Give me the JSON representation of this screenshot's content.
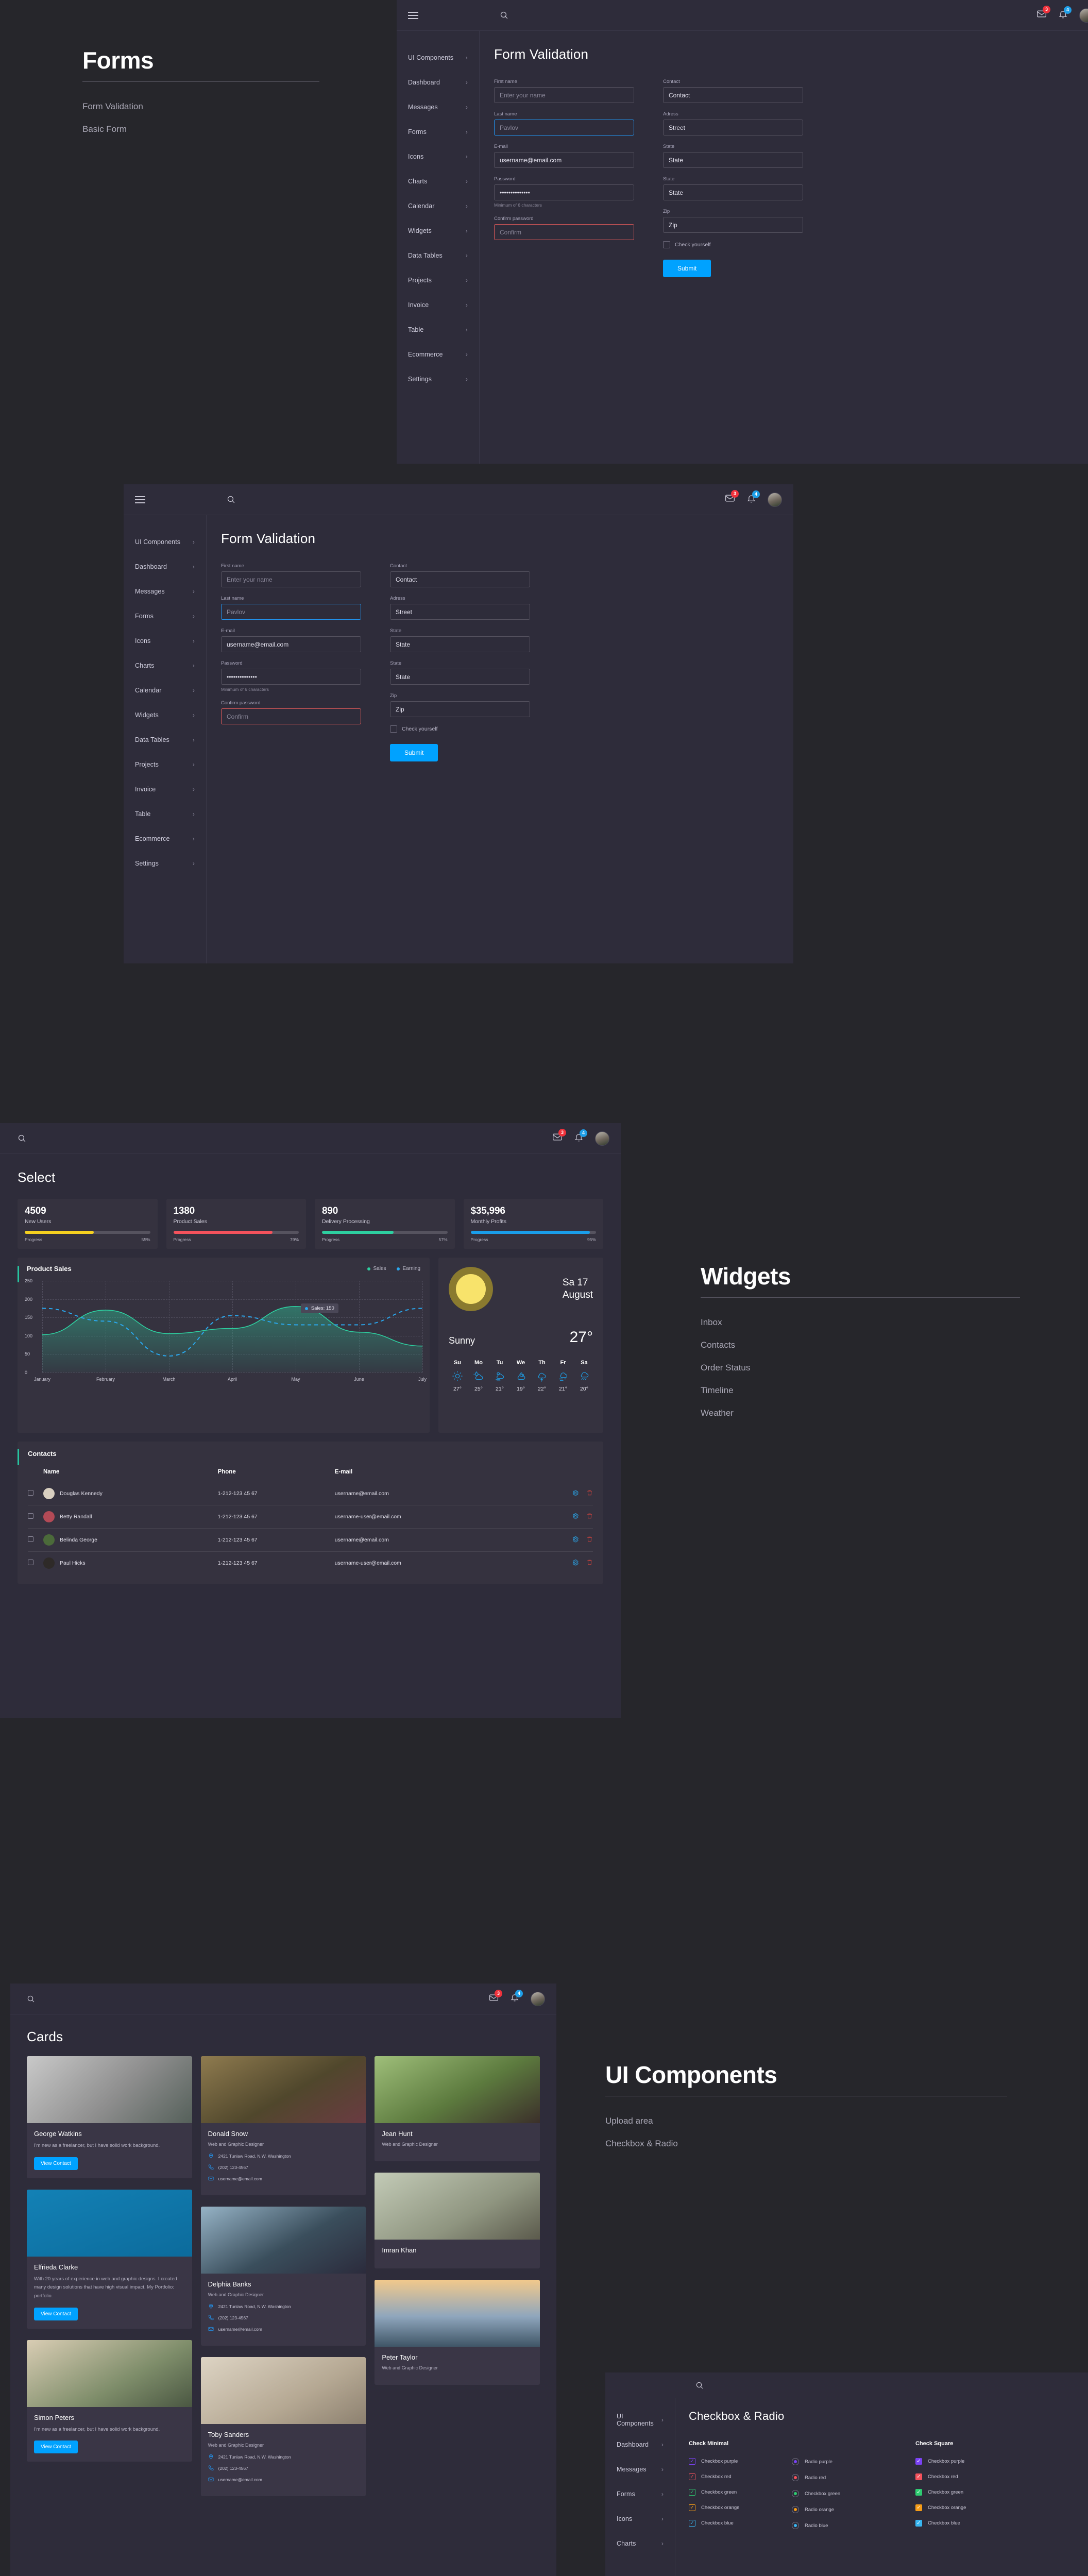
{
  "sidebar": {
    "items": [
      {
        "label": "UI Components"
      },
      {
        "label": "Dashboard"
      },
      {
        "label": "Messages"
      },
      {
        "label": "Forms"
      },
      {
        "label": "Icons"
      },
      {
        "label": "Charts"
      },
      {
        "label": "Calendar"
      },
      {
        "label": "Widgets"
      },
      {
        "label": "Data Tables"
      },
      {
        "label": "Projects"
      },
      {
        "label": "Invoice"
      },
      {
        "label": "Table"
      },
      {
        "label": "Ecommerce"
      },
      {
        "label": "Settings"
      }
    ],
    "chevron": "›"
  },
  "topbar": {
    "search_icon": "search-icon",
    "mail_badge": "3",
    "bell_badge": "4"
  },
  "hero_forms": {
    "title": "Forms",
    "links": [
      "Form Validation",
      "Basic Form"
    ]
  },
  "hero_widgets": {
    "title": "Widgets",
    "links": [
      "Inbox",
      "Contacts",
      "Order Status",
      "Timeline",
      "Weather"
    ]
  },
  "hero_ui": {
    "title": "UI Components",
    "links": [
      "Upload area",
      "Checkbox & Radio"
    ]
  },
  "form_validation": {
    "title": "Form Validation",
    "submit_label": "Submit",
    "checkbox_label": "Check yourself",
    "left_fields": [
      {
        "label": "First name",
        "value": "",
        "placeholder": "Enter your name",
        "state": "normal"
      },
      {
        "label": "Last name",
        "value": "",
        "placeholder": "Pavlov",
        "state": "focus"
      },
      {
        "label": "E-mail",
        "value": "username@email.com",
        "placeholder": "",
        "state": "filled"
      },
      {
        "label": "Password",
        "value": "••••••••••••••",
        "placeholder": "",
        "state": "filled",
        "hint": "Minimum of 6 characters"
      },
      {
        "label": "Confirm password",
        "value": "",
        "placeholder": "Confirm",
        "state": "error"
      }
    ],
    "right_fields": [
      {
        "label": "Contact",
        "value": "Contact",
        "state": "normal"
      },
      {
        "label": "Adress",
        "value": "Street",
        "state": "normal"
      },
      {
        "label": "State",
        "value": "State",
        "state": "normal"
      },
      {
        "label": "State",
        "value": "State",
        "state": "normal"
      },
      {
        "label": "Zip",
        "value": "Zip",
        "state": "normal"
      }
    ]
  },
  "select_page": {
    "title": "Select",
    "stats": [
      {
        "value": "4509",
        "label": "New Users",
        "progress_label": "Progress",
        "percent": "55%",
        "pct": 55,
        "color": "#f5d020"
      },
      {
        "value": "1380",
        "label": "Product Sales",
        "progress_label": "Progress",
        "percent": "79%",
        "pct": 79,
        "color": "#f4525c"
      },
      {
        "value": "890",
        "label": "Delivery Processing",
        "progress_label": "Progress",
        "percent": "57%",
        "pct": 57,
        "color": "#2ecfa0"
      },
      {
        "value": "$35,996",
        "label": "Monthly Profits",
        "progress_label": "Progress",
        "percent": "95%",
        "pct": 95,
        "color": "#1a9eea"
      }
    ]
  },
  "chart_data": {
    "type": "area",
    "title": "Product Sales",
    "xlabel": "",
    "ylabel": "",
    "ylim": [
      0,
      250
    ],
    "yticks": [
      0,
      50,
      100,
      150,
      200,
      250
    ],
    "categories": [
      "January",
      "February",
      "March",
      "April",
      "May",
      "June",
      "July"
    ],
    "grid": true,
    "legend_position": "top-right",
    "annotation": "Sales: 150",
    "series": [
      {
        "name": "Sales",
        "color": "#2ecfa0",
        "style": "solid-area",
        "values": [
          103,
          170,
          106,
          120,
          180,
          110,
          72
        ]
      },
      {
        "name": "Earning",
        "color": "#2aa8ef",
        "style": "dashed",
        "values": [
          175,
          140,
          45,
          155,
          130,
          130,
          175
        ]
      }
    ]
  },
  "weather": {
    "icon": "sun-icon",
    "date_line1": "Sa 17",
    "date_line2": "August",
    "condition": "Sunny",
    "temperature": "27°",
    "forecast": [
      {
        "day": "Su",
        "icon": "sun-icon",
        "temp": "27°"
      },
      {
        "day": "Mo",
        "icon": "sun-cloud-icon",
        "temp": "25°"
      },
      {
        "day": "Tu",
        "icon": "sun-cloud-fog-icon",
        "temp": "21°"
      },
      {
        "day": "We",
        "icon": "moon-cloud-icon",
        "temp": "19°"
      },
      {
        "day": "Th",
        "icon": "cloud-lightning-icon",
        "temp": "22°"
      },
      {
        "day": "Fr",
        "icon": "cloud-wind-icon",
        "temp": "21°"
      },
      {
        "day": "Sa",
        "icon": "cloud-rain-icon",
        "temp": "20°"
      }
    ]
  },
  "contacts": {
    "title": "Contacts",
    "columns": [
      "Name",
      "Phone",
      "E-mail"
    ],
    "rows": [
      {
        "name": "Douglas Kennedy",
        "phone": "1-212-123 45 67",
        "email": "username@email.com",
        "avatar": "#d8cfc0"
      },
      {
        "name": "Betty Randall",
        "phone": "1-212-123 45 67",
        "email": "username-user@email.com",
        "avatar": "#b34a56"
      },
      {
        "name": "Belinda George",
        "phone": "1-212-123 45 67",
        "email": "username@email.com",
        "avatar": "#4b6a3a"
      },
      {
        "name": "Paul Hicks",
        "phone": "1-212-123 45 67",
        "email": "username-user@email.com",
        "avatar": "#2e2a28"
      }
    ]
  },
  "cards_page": {
    "title": "Cards",
    "view_contact_label": "View Contact",
    "items": [
      {
        "name": "George Watkins",
        "type": "bio",
        "bio": "I'm new as a freelancer, but I have solid work background.",
        "photo": "linear-gradient(135deg,#c9c9c9,#8e8e8e 55%,#55605a)"
      },
      {
        "name": "Elfrieda Clarke",
        "type": "bio",
        "bio": "With 20 years of experience in web and graphic designs. I created many design solutions that have high visual impact. My Portfolio: portfolio.",
        "photo": "linear-gradient(160deg,#1381b5,#0c6b9c)"
      },
      {
        "name": "Simon Peters",
        "type": "bio",
        "bio": "I'm new as a freelancer, but I have solid work background.",
        "photo": "linear-gradient(150deg,#d9cdb4,#7e8d6a 60%,#4a5742)"
      },
      {
        "name": "Donald Snow",
        "type": "contact",
        "role": "Web and Graphic Designer",
        "address": "2421 Tunlaw Road, N.W. Washington",
        "phone": "(202) 123-4567",
        "email": "username@email.com",
        "photo": "linear-gradient(150deg,#8f7b4f,#50472c 55%,#6a3b42)"
      },
      {
        "name": "Delphia Banks",
        "type": "contact",
        "role": "Web and Graphic Designer",
        "address": "2421 Tunlaw Road, N.W. Washington",
        "phone": "(202) 123-4567",
        "email": "username@email.com",
        "photo": "linear-gradient(150deg,#96b3c6,#3a4e5c 55%,#2b2b3c)"
      },
      {
        "name": "Toby Sanders",
        "type": "contact",
        "role": "Web and Graphic Designer",
        "address": "2421 Tunlaw Road, N.W. Washington",
        "phone": "(202) 123-4567",
        "email": "username@email.com",
        "photo": "linear-gradient(150deg,#ddd4c4,#b5a893 60%,#8d8170)"
      },
      {
        "name": "Jean Hunt",
        "type": "contact",
        "role": "Web and Graphic Designer",
        "address": "",
        "phone": "",
        "email": "",
        "photo": "linear-gradient(150deg,#9fbf7a,#5c7a3e 55%,#3b2f2a)"
      },
      {
        "name": "Imran Khan",
        "type": "contact",
        "role": "",
        "address": "",
        "phone": "",
        "email": "",
        "photo": "linear-gradient(150deg,#c3cbb7,#8f9580 60%,#5b5a4c)"
      },
      {
        "name": "Peter Taylor",
        "type": "contact",
        "role": "Web and Graphic Designer",
        "address": "",
        "phone": "",
        "email": "",
        "photo": "linear-gradient(180deg,#f2c98b,#8fa6bd 55%,#3f5566)"
      }
    ]
  },
  "checkbox_radio": {
    "title": "Checkbox & Radio",
    "col1_title": "Check Minimal",
    "col3_title": "Check Square",
    "minimal": [
      {
        "label": "Checkbox purple",
        "color": "#7a42f4"
      },
      {
        "label": "Checkbox  red",
        "color": "#f4525c"
      },
      {
        "label": "Checkbox green",
        "color": "#2ecc71"
      },
      {
        "label": "Checkbox orange",
        "color": "#f59c17"
      },
      {
        "label": "Checkbox blue",
        "color": "#38b6f1"
      }
    ],
    "radios": [
      {
        "label": "Radio purple",
        "color": "#7a42f4"
      },
      {
        "label": "Radio  red",
        "color": "#f4525c"
      },
      {
        "label": "Checkbox green",
        "color": "#2ecc71"
      },
      {
        "label": "Radio orange",
        "color": "#f59c17"
      },
      {
        "label": "Radio blue",
        "color": "#38b6f1"
      }
    ],
    "square": [
      {
        "label": "Checkbox purple",
        "color": "#7a42f4"
      },
      {
        "label": "Checkbox  red",
        "color": "#f4525c"
      },
      {
        "label": "Checkbox green",
        "color": "#2ecc71"
      },
      {
        "label": "Checkbox orange",
        "color": "#f59c17"
      },
      {
        "label": "Checkbox blue",
        "color": "#38b6f1"
      }
    ]
  }
}
